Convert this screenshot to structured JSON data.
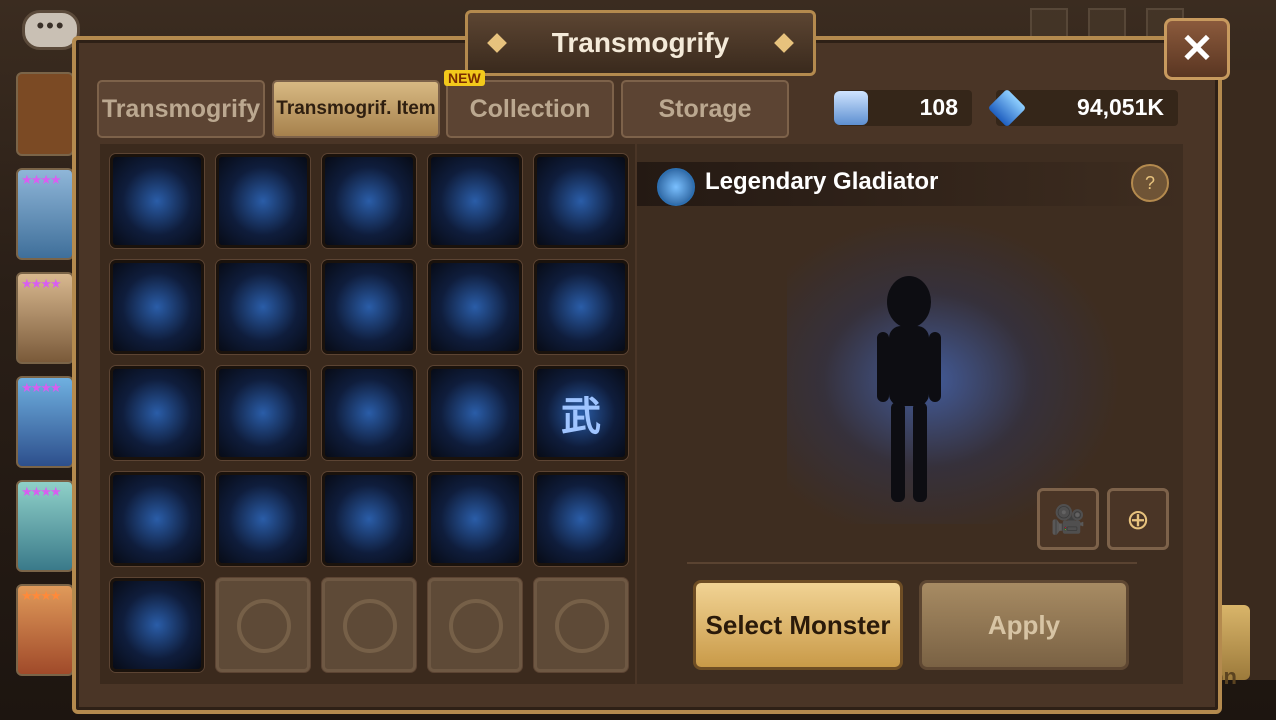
{
  "header": {
    "title": "Transmogrify",
    "close_label": "✕"
  },
  "tabs": [
    {
      "label": "Transmogrify",
      "active": false
    },
    {
      "label": "Transmogrif. Item",
      "active": true
    },
    {
      "label": "Collection",
      "active": false,
      "badge": "NEW"
    },
    {
      "label": "Storage",
      "active": false
    }
  ],
  "currency": {
    "rune_scroll": {
      "icon": "mystic-scroll-icon",
      "value": "108"
    },
    "crystal": {
      "icon": "crystal-icon",
      "value": "94,051K"
    }
  },
  "detail": {
    "item_name": "Legendary Gladiator",
    "help_label": "?",
    "buttons": {
      "select_monster": "Select Monster",
      "apply": "Apply"
    },
    "tools": {
      "video": "video-camera-icon",
      "zoom": "zoom-in-icon"
    }
  },
  "grid": {
    "filled_slots": 21,
    "empty_slots": 4,
    "special_glyph": "武"
  },
  "background": {
    "right_button_text": "on"
  },
  "colors": {
    "accent_gold": "#b48a4e",
    "panel": "#4a3526",
    "effect_blue": "#2a5da8"
  }
}
